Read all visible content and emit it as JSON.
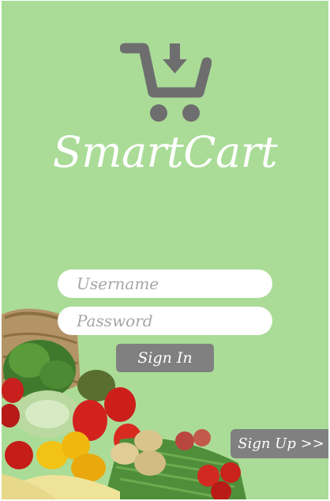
{
  "app": {
    "title": "SmartCart"
  },
  "login_form": {
    "username_placeholder": "Username",
    "username_value": "",
    "password_placeholder": "Password",
    "password_value": "",
    "signin_label": "Sign In"
  },
  "signup": {
    "label": "Sign Up >>"
  },
  "icons": {
    "logo": "cart-download-icon"
  },
  "colors": {
    "background": "#aadc98",
    "button": "#808080",
    "logo": "#6e6e6e",
    "title": "#ffffff"
  }
}
